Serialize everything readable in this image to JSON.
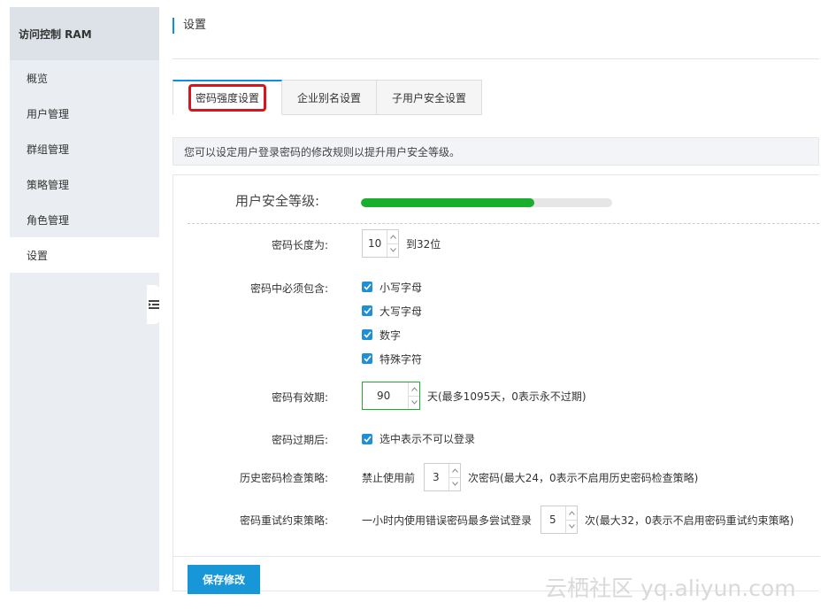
{
  "sidebar": {
    "title": "访问控制 RAM",
    "items": [
      {
        "label": "概览"
      },
      {
        "label": "用户管理"
      },
      {
        "label": "群组管理"
      },
      {
        "label": "策略管理"
      },
      {
        "label": "角色管理"
      },
      {
        "label": "设置"
      }
    ],
    "active_index": 5
  },
  "header": {
    "title": "设置"
  },
  "tabs": [
    {
      "label": "密码强度设置"
    },
    {
      "label": "企业别名设置"
    },
    {
      "label": "子用户安全设置"
    }
  ],
  "info": {
    "text": "您可以设定用户登录密码的修改规则以提升用户安全等级。"
  },
  "security": {
    "label": "用户安全等级:",
    "level": 0.69,
    "bar_color": "#1aae2d"
  },
  "form": {
    "length": {
      "label": "密码长度为:",
      "value": "10",
      "suffix": "到32位"
    },
    "must_contain": {
      "label": "密码中必须包含:",
      "options": [
        {
          "label": "小写字母",
          "checked": true
        },
        {
          "label": "大写字母",
          "checked": true
        },
        {
          "label": "数字",
          "checked": true
        },
        {
          "label": "特殊字符",
          "checked": true
        }
      ]
    },
    "validity": {
      "label": "密码有效期:",
      "value": "90",
      "suffix": "天(最多1095天，0表示永不过期)"
    },
    "after_expire": {
      "label": "密码过期后:",
      "checkbox_label": "选中表示不可以登录",
      "checked": true
    },
    "history": {
      "label": "历史密码检查策略:",
      "prefix": "禁止使用前",
      "value": "3",
      "suffix": "次密码(最大24，0表示不启用历史密码检查策略)"
    },
    "retry": {
      "label": "密码重试约束策略:",
      "prefix": "一小时内使用错误密码最多尝试登录",
      "value": "5",
      "suffix": "次(最大32，0表示不启用密码重试约束策略)"
    }
  },
  "actions": {
    "save_label": "保存修改"
  },
  "watermark": {
    "text": "云栖社区 yq.aliyun.com"
  },
  "colors": {
    "accent": "#0c8ee6",
    "primary_button": "#1796d8",
    "highlight": "#d9151b"
  }
}
